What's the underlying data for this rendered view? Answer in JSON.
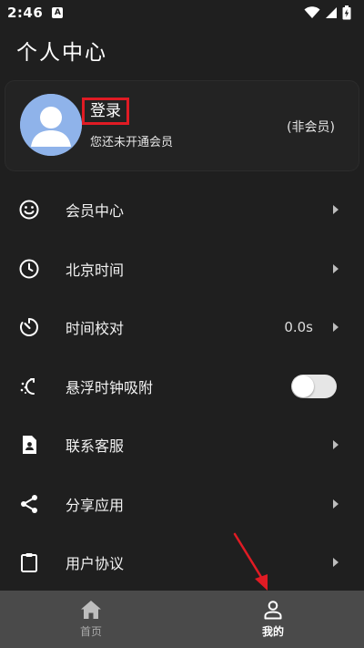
{
  "status_bar": {
    "time": "2:46",
    "notification_badge": "A"
  },
  "page": {
    "title": "个人中心"
  },
  "profile": {
    "login_label": "登录",
    "membership_status": "您还未开通会员",
    "member_tag": "(非会员)"
  },
  "menu": {
    "items": [
      {
        "label": "会员中心",
        "icon": "smile-icon"
      },
      {
        "label": "北京时间",
        "icon": "clock-icon"
      },
      {
        "label": "时间校对",
        "icon": "timer-sync-icon",
        "value": "0.0s"
      },
      {
        "label": "悬浮时钟吸附",
        "icon": "magic-attach-icon",
        "toggle_on": false
      },
      {
        "label": "联系客服",
        "icon": "contact-card-icon"
      },
      {
        "label": "分享应用",
        "icon": "share-icon"
      },
      {
        "label": "用户协议",
        "icon": "clipboard-icon"
      }
    ]
  },
  "bottom_nav": {
    "tabs": [
      {
        "label": "首页",
        "icon": "home-icon",
        "active": false
      },
      {
        "label": "我的",
        "icon": "person-icon",
        "active": true
      }
    ]
  },
  "colors": {
    "background": "#1f1f1f",
    "card": "#232323",
    "nav_bar": "#4a4a4a",
    "annotation_red": "#e01b24",
    "avatar_blue": "#8fb3ea"
  }
}
